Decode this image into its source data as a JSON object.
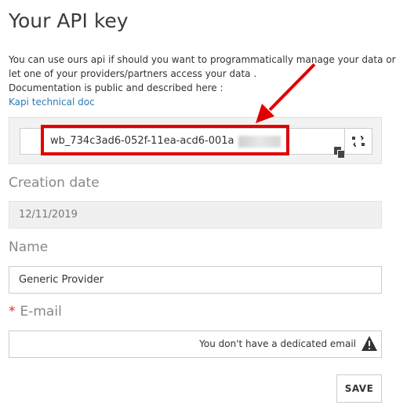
{
  "page": {
    "title": "Your API key",
    "description_lines": [
      "You can use ours api if should you want to programmatically manage your data or to",
      "let one of your providers/partners access your data .",
      "Documentation is public and described here :"
    ],
    "doc_link": "Kapi technical doc"
  },
  "api_key": {
    "value": "wb_734c3ad6-052f-11ea-acd6-001a",
    "value_obscured": true
  },
  "form": {
    "creation_date_label": "Creation date",
    "creation_date_value": "12/11/2019",
    "name_label": "Name",
    "name_value": "Generic Provider",
    "email_required_marker": "*",
    "email_label": "E-mail",
    "email_message": "You don't have a dedicated email",
    "save_label": "SAVE"
  },
  "colors": {
    "highlight": "#e00000",
    "link": "#2a7bb8",
    "required": "#d9332b"
  },
  "icons": {
    "copy": "copy-icon",
    "regenerate": "regenerate-icon",
    "warning": "warning-icon"
  }
}
